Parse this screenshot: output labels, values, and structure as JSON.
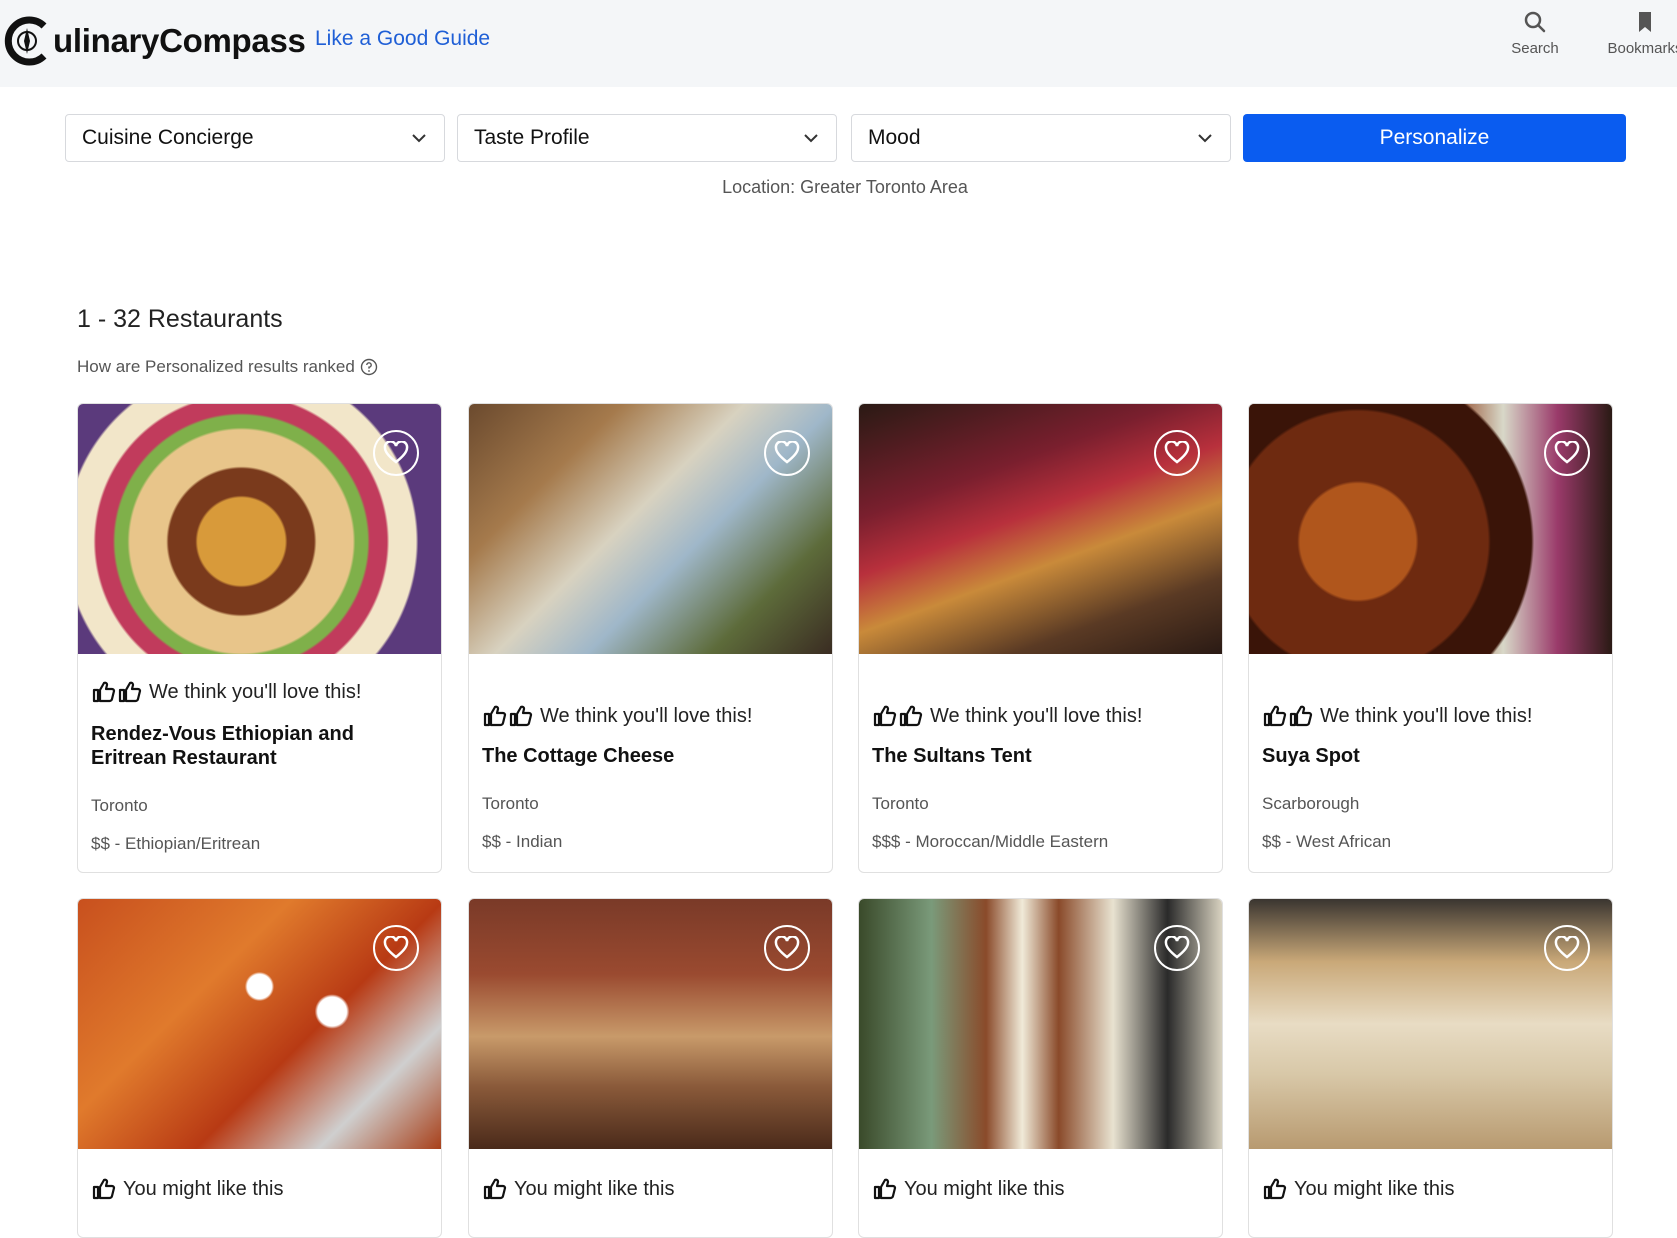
{
  "header": {
    "logo_text": "ulinaryCompass",
    "tagline": "Like a Good Guide",
    "search_label": "Search",
    "bookmarks_label": "Bookmarks"
  },
  "filters": {
    "cuisine": "Cuisine Concierge",
    "taste": "Taste Profile",
    "mood": "Mood",
    "personalize_label": "Personalize",
    "location": "Location: Greater Toronto Area"
  },
  "results": {
    "count_label": "1 - 32 Restaurants",
    "ranked_label": "How are Personalized results ranked"
  },
  "cards": [
    {
      "badge": "We think you'll love this!",
      "name": "Rendez-Vous Ethiopian and Eritrean Restaurant",
      "city": "Toronto",
      "details": "$$ - Ethiopian/Eritrean"
    },
    {
      "badge": "We think you'll love this!",
      "name": "The Cottage Cheese",
      "city": "Toronto",
      "details": "$$ - Indian"
    },
    {
      "badge": "We think you'll love this!",
      "name": "The Sultans Tent",
      "city": "Toronto",
      "details": "$$$ - Moroccan/Middle Eastern"
    },
    {
      "badge": "We think you'll love this!",
      "name": "Suya Spot",
      "city": "Scarborough",
      "details": "$$ - West African"
    },
    {
      "badge": "You might like this"
    },
    {
      "badge": "You might like this"
    },
    {
      "badge": "You might like this"
    },
    {
      "badge": "You might like this"
    }
  ],
  "colors": {
    "accent": "#0a5cf0",
    "tagline": "#1f5fd6",
    "header_bg": "#f4f6f8"
  }
}
